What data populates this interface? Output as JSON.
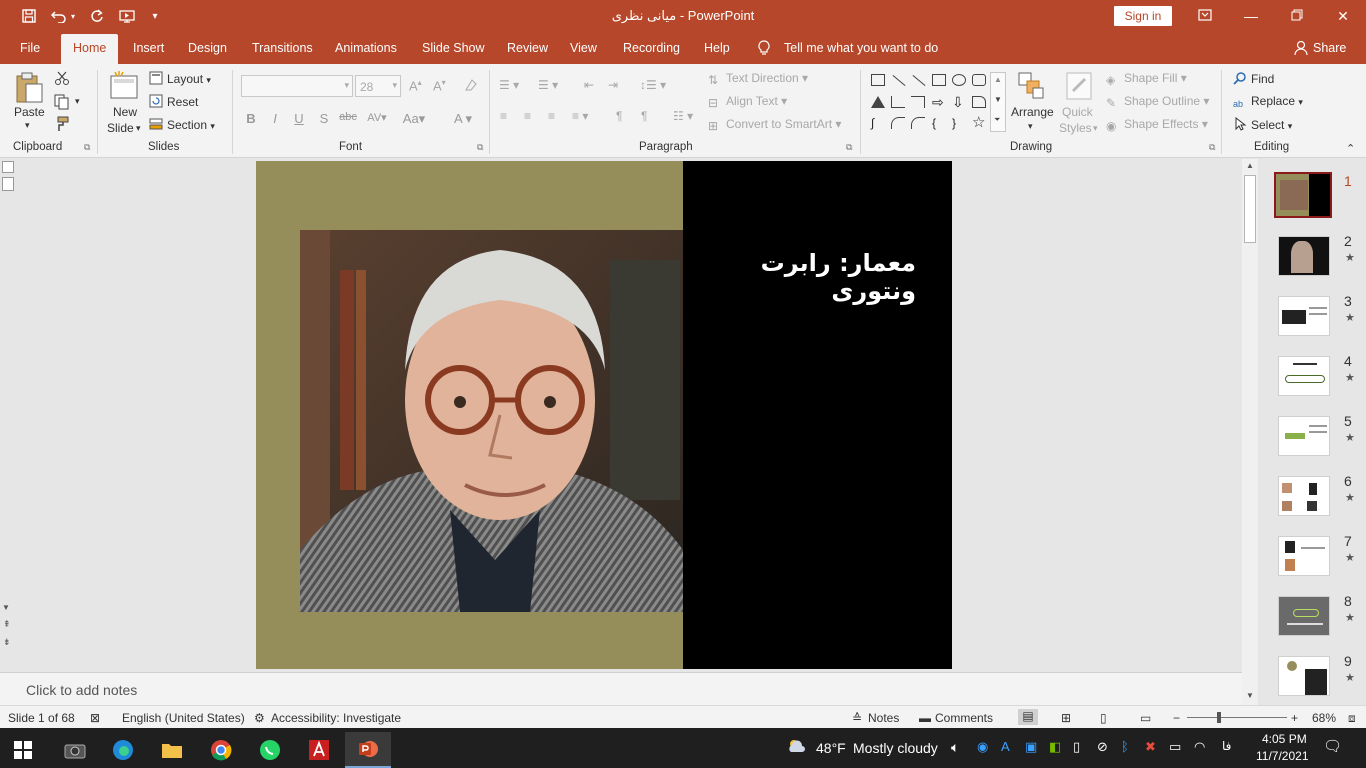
{
  "window": {
    "title": "میانی نظری  -  PowerPoint",
    "sign_in": "Sign in"
  },
  "tabs": {
    "file": "File",
    "home": "Home",
    "insert": "Insert",
    "design": "Design",
    "transitions": "Transitions",
    "animations": "Animations",
    "slideshow": "Slide Show",
    "review": "Review",
    "view": "View",
    "recording": "Recording",
    "help": "Help",
    "tell_me": "Tell me what you want to do",
    "share": "Share"
  },
  "ribbon": {
    "clipboard": {
      "paste": "Paste",
      "label": "Clipboard"
    },
    "slides": {
      "new_slide_1": "New",
      "new_slide_2": "Slide",
      "layout": "Layout",
      "reset": "Reset",
      "section": "Section",
      "label": "Slides"
    },
    "font": {
      "size": "28",
      "label": "Font"
    },
    "paragraph": {
      "text_direction": "Text Direction",
      "align_text": "Align Text",
      "convert_smartart": "Convert to SmartArt",
      "label": "Paragraph"
    },
    "drawing": {
      "arrange": "Arrange",
      "quick_styles_1": "Quick",
      "quick_styles_2": "Styles",
      "shape_fill": "Shape Fill",
      "shape_outline": "Shape Outline",
      "shape_effects": "Shape Effects",
      "label": "Drawing"
    },
    "editing": {
      "find": "Find",
      "replace": "Replace",
      "select": "Select",
      "label": "Editing"
    }
  },
  "slide": {
    "title": "معمار: رابرت ونتوری"
  },
  "thumbnails": [
    {
      "num": "1"
    },
    {
      "num": "2"
    },
    {
      "num": "3"
    },
    {
      "num": "4"
    },
    {
      "num": "5"
    },
    {
      "num": "6"
    },
    {
      "num": "7"
    },
    {
      "num": "8"
    },
    {
      "num": "9"
    }
  ],
  "thumbnail_star": "★",
  "notes": {
    "placeholder": "Click to add notes"
  },
  "status": {
    "slide_count": "Slide 1 of 68",
    "language": "English (United States)",
    "accessibility": "Accessibility: Investigate",
    "notes": "Notes",
    "comments": "Comments",
    "zoom": "68%"
  },
  "taskbar": {
    "weather_temp": "48°F",
    "weather_desc": "Mostly cloudy",
    "lang": "فا",
    "time": "4:05 PM",
    "date": "11/7/2021"
  }
}
